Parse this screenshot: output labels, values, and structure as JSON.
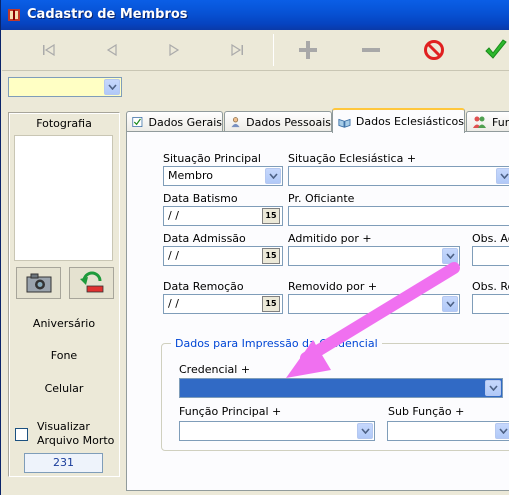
{
  "window": {
    "title": "Cadastro de Membros"
  },
  "toolbar": {
    "first": "first-record",
    "prev": "previous-record",
    "next": "next-record",
    "last": "last-record",
    "add": "add",
    "remove": "remove",
    "cancel": "cancel",
    "confirm": "confirm"
  },
  "top_combo": {
    "value": ""
  },
  "left": {
    "photo_label": "Fotografia",
    "birthday": "Aniversário",
    "phone": "Fone",
    "cell": "Celular",
    "archive_label": "Visualizar Arquivo Morto",
    "count": "231"
  },
  "tabs": [
    {
      "label": "Dados Gerais"
    },
    {
      "label": "Dados Pessoais"
    },
    {
      "label": "Dados Eclesiásticos"
    },
    {
      "label": "Func"
    }
  ],
  "form": {
    "situacao_principal_label": "Situação Principal",
    "situacao_principal_value": "Membro",
    "situacao_ecl_label": "Situação Eclesiástica +",
    "data_batismo_label": "Data Batismo",
    "data_batismo_value": " /  /",
    "pr_oficiante_label": "Pr. Oficiante",
    "data_admissao_label": "Data Admissão",
    "data_admissao_value": " /  /",
    "admitido_por_label": "Admitido por +",
    "obs_ad_label": "Obs. Ad",
    "data_remocao_label": "Data Remoção",
    "data_remocao_value": " /  /",
    "removido_por_label": "Removido por +",
    "obs_re_label": "Obs. Re",
    "date_btn": "15",
    "group_title": "Dados para Impressão da Credencial",
    "credencial_label": "Credencial +",
    "funcao_label": "Função Principal +",
    "subfuncao_label": "Sub Função +"
  }
}
